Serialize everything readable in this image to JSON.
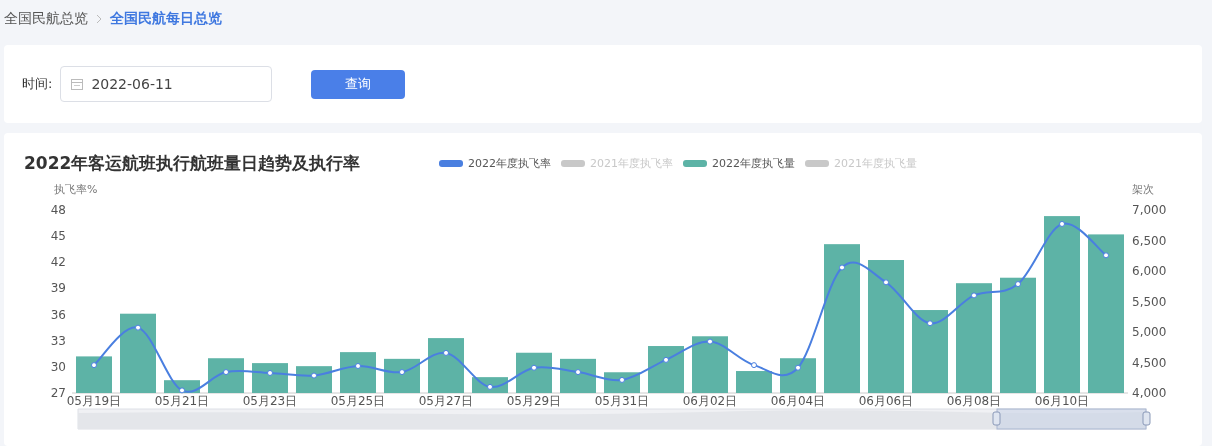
{
  "breadcrumb": [
    {
      "label": "全国民航总览",
      "selected": false
    },
    {
      "label": "全国民航每日总览",
      "selected": true
    }
  ],
  "filter": {
    "label": "时间:",
    "date": "2022-06-11",
    "button": "查询"
  },
  "chart": {
    "title": "2022年客运航班执行航班量日趋势及执行率",
    "legend": [
      {
        "kind": "series",
        "on": true
      },
      {
        "label": "2021年度执飞率",
        "color": "#c8c8c8",
        "on": false
      },
      {
        "kind": "series",
        "on": true
      },
      {
        "label": "2021年度执飞量",
        "color": "#c8c8c8",
        "on": false
      }
    ],
    "chart_data": {
      "type": "bar",
      "ylabel": "架次",
      "y2label": "执飞率%",
      "categories": [
        "05月19日",
        null,
        "05月21日",
        null,
        "05月23日",
        null,
        "05月25日",
        null,
        "05月27日",
        null,
        "05月29日",
        null,
        "05月31日",
        null,
        "06月02日",
        null,
        "06月04日",
        null,
        "06月06日",
        null,
        "06月08日",
        null,
        "06月10日",
        null
      ],
      "yticks": [
        {
          "value": 7000,
          "label": "7,000"
        },
        {
          "value": 6500,
          "label": "6,500"
        },
        {
          "value": 6000,
          "label": "6,000"
        },
        {
          "value": 5500,
          "label": "5,500"
        },
        {
          "value": 5000,
          "label": "5,000"
        },
        {
          "value": 4500,
          "label": "4,500"
        },
        {
          "value": 4000,
          "label": "4,000"
        }
      ],
      "ylim": [
        4000,
        7000
      ],
      "y2ticks": [
        {
          "value": 48,
          "label": "48"
        },
        {
          "value": 45,
          "label": "45"
        },
        {
          "value": 42,
          "label": "42"
        },
        {
          "value": 39,
          "label": "39"
        },
        {
          "value": 36,
          "label": "36"
        },
        {
          "value": 33,
          "label": "33"
        },
        {
          "value": 30,
          "label": "30"
        },
        {
          "value": 27,
          "label": "27"
        }
      ],
      "y2lim": [
        27,
        48
      ],
      "series": [
        {
          "name": "2022年度执飞率",
          "type": "line",
          "axis": "y2",
          "marker": "circle",
          "color": "#4a7fe0",
          "values": [
            30.2,
            34.5,
            27.3,
            29.4,
            29.3,
            29.0,
            30.1,
            29.4,
            31.6,
            27.7,
            29.9,
            29.4,
            28.5,
            30.8,
            32.9,
            30.2,
            29.9,
            41.4,
            39.7,
            35.0,
            38.2,
            39.5,
            46.4,
            42.8
          ]
        },
        {
          "name": "2022年度执飞量",
          "type": "bar",
          "color": "#5db3a6",
          "values": [
            4600,
            5300,
            4210,
            4570,
            4490,
            4440,
            4670,
            4560,
            4900,
            4260,
            4660,
            4560,
            4340,
            4770,
            4930,
            4360,
            4570,
            6440,
            6180,
            5360,
            5800,
            5890,
            6900,
            6600
          ]
        }
      ]
    }
  }
}
